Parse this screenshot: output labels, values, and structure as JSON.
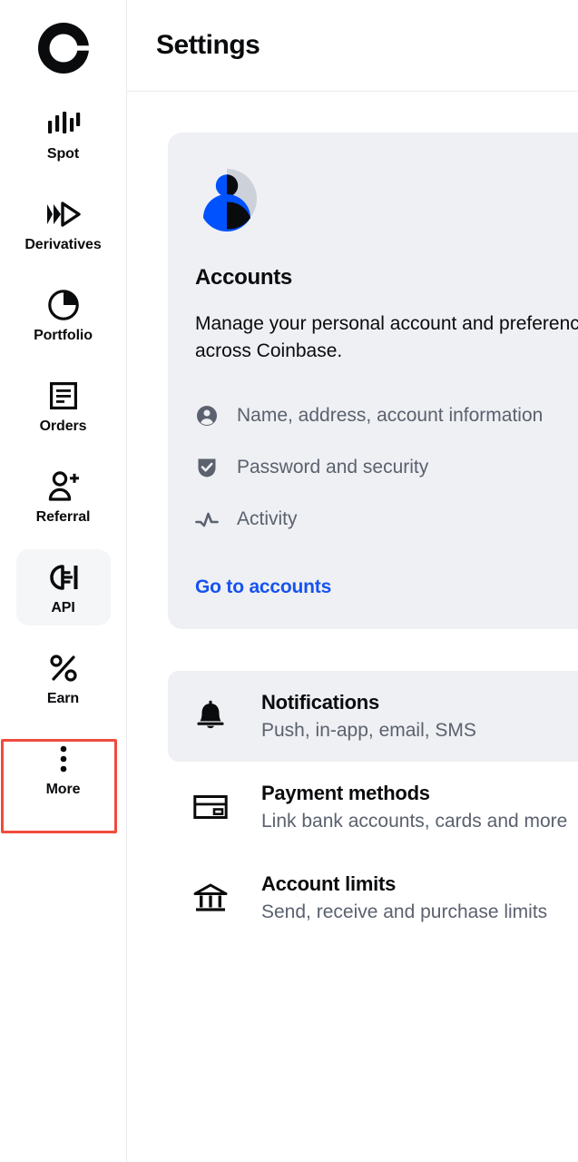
{
  "brand": {
    "logo_icon": "coinbase-logo-icon"
  },
  "sidebar": {
    "items": [
      {
        "label": "Spot",
        "icon": "candlestick-chart-icon",
        "active": false
      },
      {
        "label": "Derivatives",
        "icon": "fast-forward-icon",
        "active": false
      },
      {
        "label": "Portfolio",
        "icon": "pie-chart-icon",
        "active": false
      },
      {
        "label": "Orders",
        "icon": "document-lines-icon",
        "active": false
      },
      {
        "label": "Referral",
        "icon": "add-person-icon",
        "active": false
      },
      {
        "label": "API",
        "icon": "plug-connector-icon",
        "active": true
      },
      {
        "label": "Earn",
        "icon": "percent-icon",
        "active": false
      },
      {
        "label": "More",
        "icon": "more-vertical-icon",
        "active": false
      }
    ]
  },
  "header": {
    "title": "Settings"
  },
  "accounts_card": {
    "avatar_icon": "user-avatar-icon",
    "title": "Accounts",
    "description": "Manage your personal account and preferences\nacross Coinbase.",
    "links": [
      {
        "icon": "person-circle-icon",
        "label": "Name, address, account information"
      },
      {
        "icon": "shield-check-icon",
        "label": "Password and security"
      },
      {
        "icon": "activity-pulse-icon",
        "label": "Activity"
      }
    ],
    "cta": "Go to accounts"
  },
  "settings_rows": [
    {
      "icon": "bell-icon",
      "title": "Notifications",
      "subtitle": "Push, in-app, email, SMS",
      "hovered": true
    },
    {
      "icon": "credit-card-icon",
      "title": "Payment methods",
      "subtitle": "Link bank accounts, cards and more",
      "hovered": false
    },
    {
      "icon": "bank-institution-icon",
      "title": "Account limits",
      "subtitle": "Send, receive and purchase limits",
      "hovered": false
    }
  ],
  "colors": {
    "brand_blue": "#0052FF",
    "link_blue": "#1652F0",
    "card_bg": "#EEF0F3",
    "text_primary": "#0A0B0D",
    "text_secondary": "#5B616E",
    "selection_ring": "#EF4B3C"
  }
}
